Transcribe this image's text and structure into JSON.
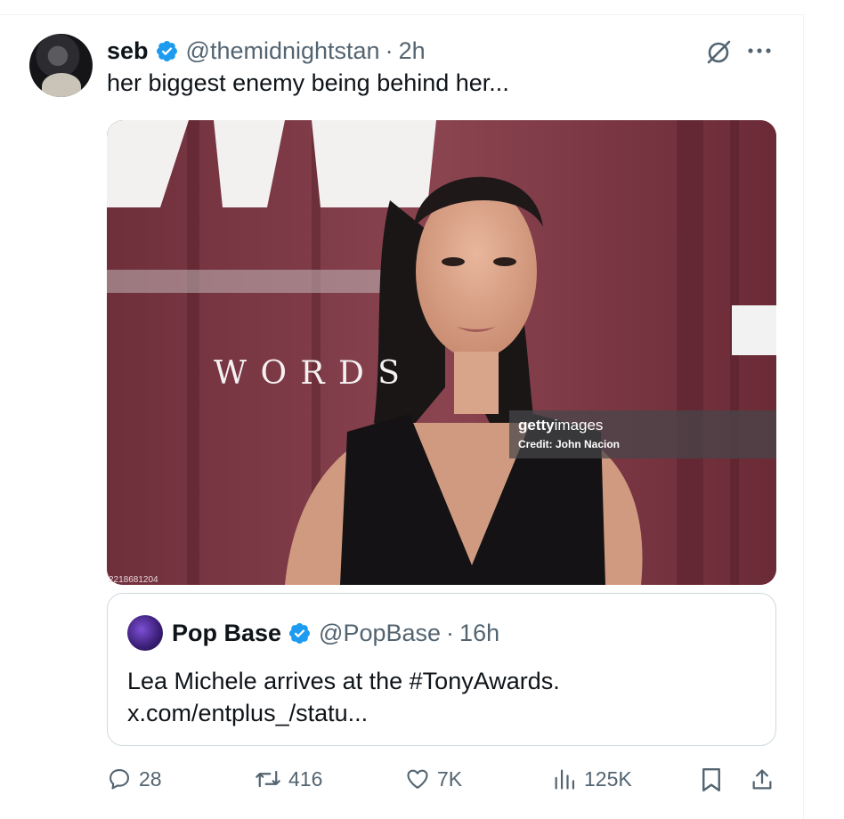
{
  "tweet": {
    "display_name": "seb",
    "handle": "@themidnightstan",
    "separator": "·",
    "time": "2h",
    "text": "her biggest enemy being behind her..."
  },
  "media": {
    "backdrop_text": "W O R D S",
    "watermark_logo_bold": "getty",
    "watermark_logo_light": "images",
    "watermark_credit": "Credit: John Nacion",
    "image_id": "2218681204"
  },
  "quoted": {
    "display_name": "Pop Base",
    "handle": "@PopBase",
    "separator": "·",
    "time": "16h",
    "text_line1": "Lea Michele arrives at the #TonyAwards.",
    "text_line2": "x.com/entplus_/statu..."
  },
  "actions": {
    "replies": "28",
    "reposts": "416",
    "likes": "7K",
    "views": "125K"
  },
  "colors": {
    "verified": "#1d9bf0",
    "secondary_text": "#536471",
    "border": "#cfd9de"
  }
}
